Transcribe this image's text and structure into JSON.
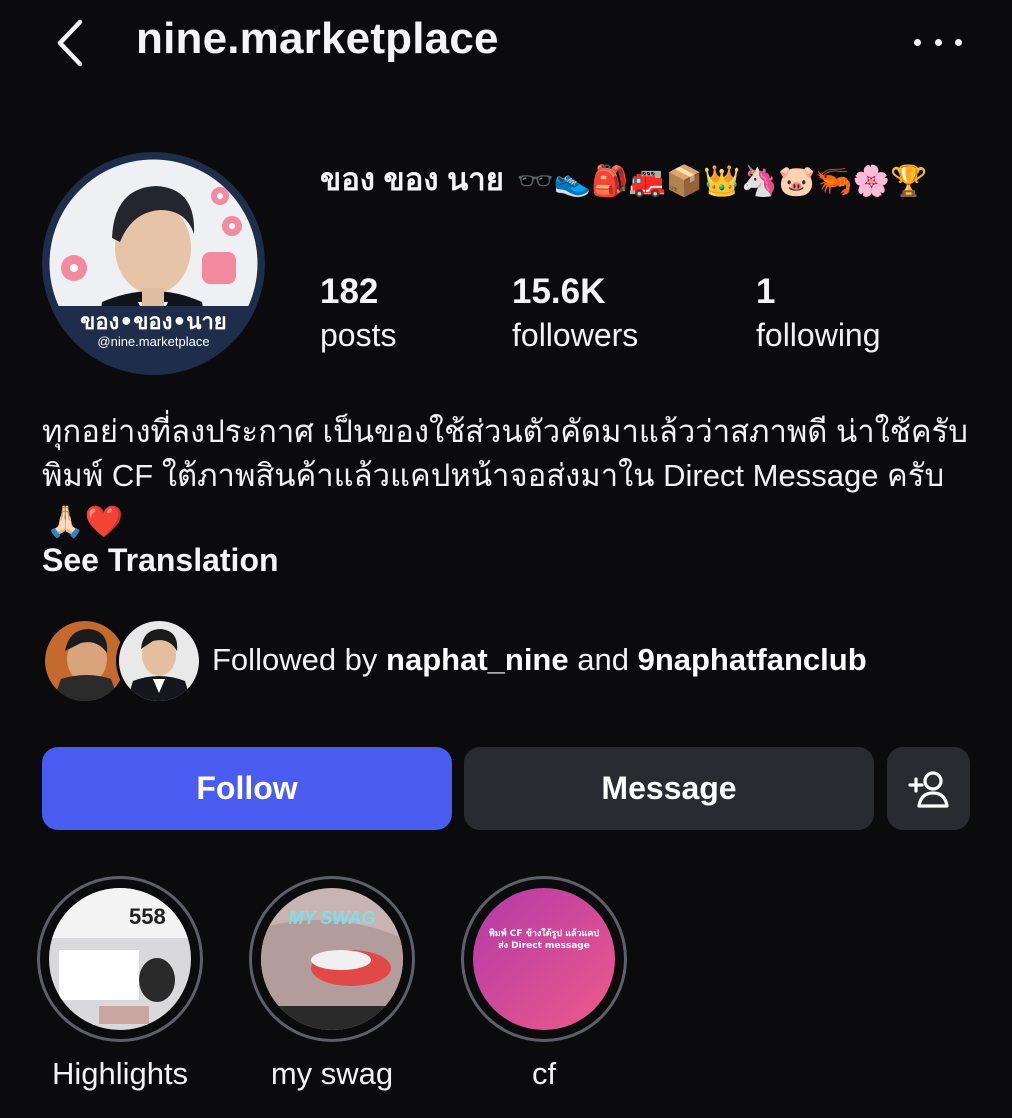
{
  "header": {
    "username": "nine.marketplace",
    "back_icon": "chevron-left-icon",
    "more_icon": "more-horizontal-icon"
  },
  "profile": {
    "display_name": "ของ ของ นาย",
    "display_emojis": "🕶️👟🎒🚒📦👑🦄🐷🦐🌸🏆",
    "avatar_caption": "ของ•ของ•นาย",
    "avatar_handle": "@nine.marketplace"
  },
  "stats": {
    "posts_count": "182",
    "posts_label": "posts",
    "followers_count": "15.6K",
    "followers_label": "followers",
    "following_count": "1",
    "following_label": "following"
  },
  "bio": {
    "text": "ทุกอย่างที่ลงประกาศ เป็นของใช้ส่วนตัวคัดมาแล้วว่าสภาพดี น่าใช้ครับ พิมพ์ CF ใต้ภาพสินค้าแล้วแคปหน้าจอส่งมาใน Direct Message ครับ",
    "emojis": "🙏🏻❤️",
    "see_translation": "See Translation"
  },
  "followed_by": {
    "prefix": "Followed by ",
    "user1": "naphat_nine",
    "conj": " and ",
    "user2": "9naphatfanclub"
  },
  "actions": {
    "follow_label": "Follow",
    "message_label": "Message",
    "add_user_icon": "add-person-icon"
  },
  "highlights": [
    {
      "label": "Highlights",
      "cover_text": "558"
    },
    {
      "label": "my swag",
      "cover_text": "MY SWAG"
    },
    {
      "label": "cf",
      "cover_text": "พิมพ์ CF ข้างใต้รูป แล้วแคปส่ง Direct message"
    }
  ],
  "colors": {
    "background": "#0b0b0e",
    "follow_button": "#4a5cf0",
    "secondary_button": "#2a2b31",
    "highlight_ring": "#5d6068"
  }
}
